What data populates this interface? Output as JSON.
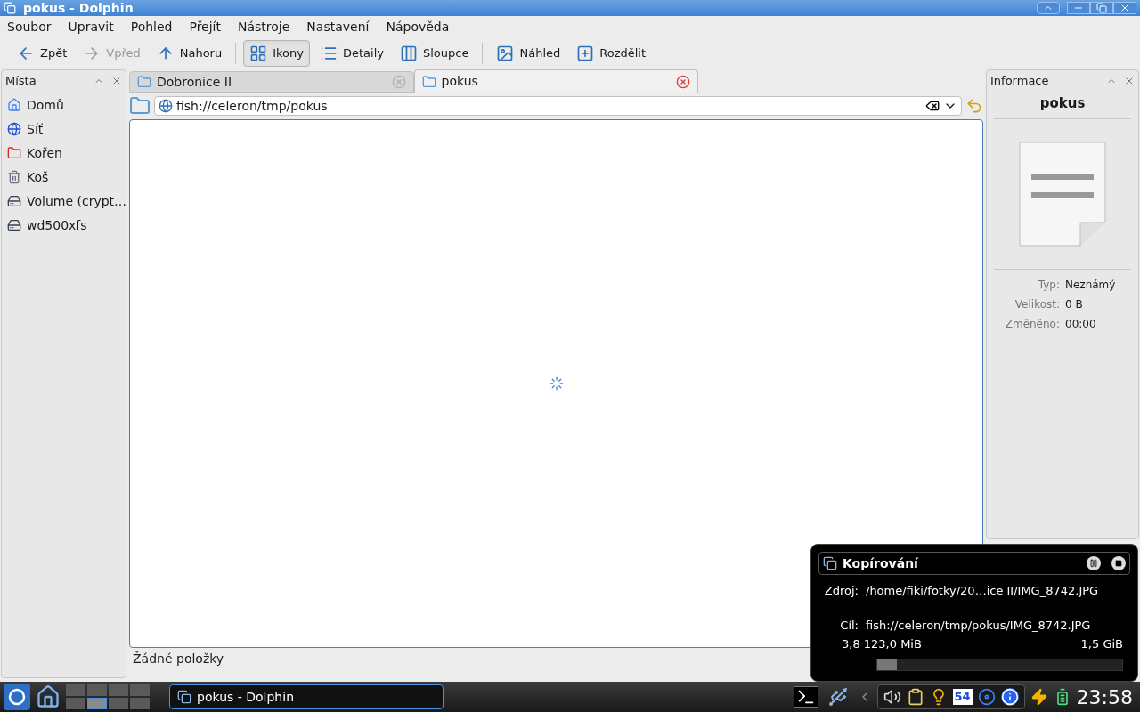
{
  "window": {
    "title": "pokus - Dolphin"
  },
  "menu": [
    "Soubor",
    "Upravit",
    "Pohled",
    "Přejít",
    "Nástroje",
    "Nastavení",
    "Nápověda"
  ],
  "toolbar": {
    "groups": [
      [
        {
          "label": "Zpět",
          "disabled": false,
          "selected": false
        },
        {
          "label": "Vpřed",
          "disabled": true,
          "selected": false
        },
        {
          "label": "Nahoru",
          "disabled": false,
          "selected": false
        }
      ],
      [
        {
          "label": "Ikony",
          "disabled": false,
          "selected": true
        },
        {
          "label": "Detaily",
          "disabled": false,
          "selected": false
        },
        {
          "label": "Sloupce",
          "disabled": false,
          "selected": false
        }
      ],
      [
        {
          "label": "Náhled",
          "disabled": false,
          "selected": false
        },
        {
          "label": "Rozdělit",
          "disabled": false,
          "selected": false
        }
      ]
    ]
  },
  "places": {
    "title": "Místa",
    "items": [
      "Domů",
      "Síť",
      "Kořen",
      "Koš",
      "Volume (crypt…",
      "wd500xfs"
    ]
  },
  "tabs": [
    {
      "label": "Dobronice II",
      "selected": false
    },
    {
      "label": "pokus",
      "selected": true
    }
  ],
  "location": {
    "value": "fish://celeron/tmp/pokus"
  },
  "status_bar": "Žádné položky",
  "info_panel": {
    "title": "Informace",
    "name": "pokus",
    "rows": [
      {
        "label": "Typ:",
        "value": "Neznámý"
      },
      {
        "label": "Velikost:",
        "value": "0 B"
      },
      {
        "label": "Změněno:",
        "value": "00:00"
      }
    ]
  },
  "copy_job": {
    "title": "Kopírování",
    "source_label": "Zdroj:",
    "source": "/home/fiki/fotky/20…ice II/IMG_8742.JPG",
    "dest_label": "Cíl:",
    "dest": "fish://celeron/tmp/pokus/IMG_8742.JPG",
    "processed": "3,8 123,0 MiB",
    "total": "1,5 GiB",
    "level": 0.08
  },
  "taskbar": {
    "desktops": [
      {
        "selected": false
      },
      {
        "selected": false
      },
      {
        "selected": false
      },
      {
        "selected": false
      },
      {
        "selected": false
      },
      {
        "selected": true
      },
      {
        "selected": false
      },
      {
        "selected": false
      }
    ],
    "task": "pokus - Dolphin",
    "tray_badge": "54",
    "clock": "23:58"
  }
}
